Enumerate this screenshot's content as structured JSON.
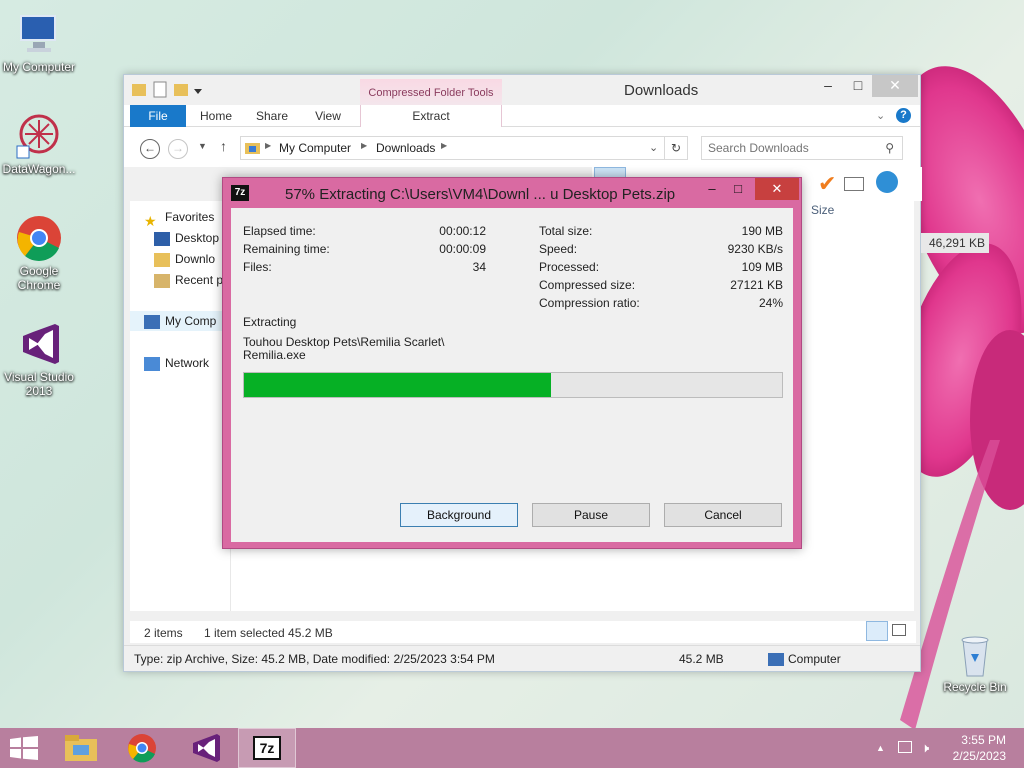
{
  "desktop": {
    "icons": [
      {
        "label": "My Computer"
      },
      {
        "label": "DataWagon..."
      },
      {
        "label": "Google Chrome"
      },
      {
        "label": "Visual Studio 2013"
      },
      {
        "label": "Recycle Bin"
      }
    ]
  },
  "explorer": {
    "title": "Downloads",
    "contextual_group": "Compressed Folder Tools",
    "tabs": [
      "File",
      "Home",
      "Share",
      "View",
      "Extract"
    ],
    "address": {
      "root": "My Computer",
      "folder": "Downloads"
    },
    "search_placeholder": "Search Downloads",
    "nav": {
      "favorites": "Favorites",
      "desktop": "Desktop",
      "downloads": "Downlo",
      "recent": "Recent p",
      "computer": "My Comp",
      "network": "Network"
    },
    "columns": {
      "size": "Size"
    },
    "selected_file_size": "46,291 KB",
    "status": {
      "items": "2 items",
      "selected": "1 item selected  45.2 MB"
    },
    "details": {
      "info": "Type: zip Archive, Size: 45.2 MB, Date modified: 2/25/2023 3:54 PM",
      "size": "45.2 MB",
      "location": "Computer"
    }
  },
  "zip_dialog": {
    "title": "57% Extracting C:\\Users\\VM4\\Downl ... u Desktop Pets.zip",
    "logo": "7z",
    "progress": 0.57,
    "left_stats": [
      {
        "label": "Elapsed time:",
        "value": "00:00:12"
      },
      {
        "label": "Remaining time:",
        "value": "00:00:09"
      },
      {
        "label": "Files:",
        "value": "34"
      }
    ],
    "right_stats": [
      {
        "label": "Total size:",
        "value": "190 MB"
      },
      {
        "label": "Speed:",
        "value": "9230 KB/s"
      },
      {
        "label": "Processed:",
        "value": "109 MB"
      },
      {
        "label": "Compressed size:",
        "value": "27121 KB"
      },
      {
        "label": "Compression ratio:",
        "value": "24%"
      }
    ],
    "action": "Extracting",
    "current_path": "Touhou Desktop Pets\\Remilia Scarlet\\",
    "current_file": "Remilia.exe",
    "buttons": {
      "background": "Background",
      "pause": "Pause",
      "cancel": "Cancel"
    }
  },
  "taskbar": {
    "time": "3:55 PM",
    "date": "2/25/2023",
    "seven_zip_label": "7z"
  },
  "colors": {
    "progress": "#06b025",
    "dialog_frame": "#d96aa2",
    "taskbar": "#b87f9e",
    "file_tab": "#1979ca"
  }
}
